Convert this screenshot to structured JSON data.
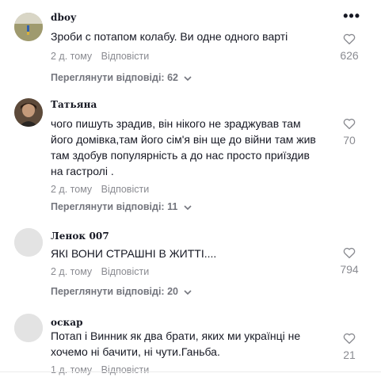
{
  "comments": [
    {
      "username": "dboy",
      "text": "Зроби с потапом колабу. Ви одне одного варті",
      "time": "2 д. тому",
      "reply_label": "Відповісти",
      "view_replies": "Переглянути відповіді: 62",
      "likes": "626",
      "avatar": "landscape-avatar"
    },
    {
      "username": "Татьяна",
      "text": "чого пишуть зрадив, він нікого не зраджував там його домівка,там його сім'я він ще до війни там жив там здобув популярність а до нас просто приїздив на гастролі .",
      "time": "2 д. тому",
      "reply_label": "Відповісти",
      "view_replies": "Переглянути відповіді: 11",
      "likes": "70",
      "avatar": "photo-avatar"
    },
    {
      "username": "Ленок 007",
      "text": "ЯКІ ВОНИ СТРАШНІ В ЖИТТІ....",
      "time": "2 д. тому",
      "reply_label": "Відповісти",
      "view_replies": "Переглянути відповіді: 20",
      "likes": "794",
      "avatar": "default-avatar"
    },
    {
      "username": "оскар",
      "text": "Потап і Винник як два брати, яких ми українці не хочемо ні бачити, ні чути.Ганьба.",
      "time": "1 д. тому",
      "reply_label": "Відповісти",
      "likes": "21",
      "avatar": "default-avatar"
    }
  ],
  "more_icon": "more-options-icon",
  "colors": {
    "text": "#161823",
    "muted": "#8a8b91",
    "replies": "#73757d"
  }
}
